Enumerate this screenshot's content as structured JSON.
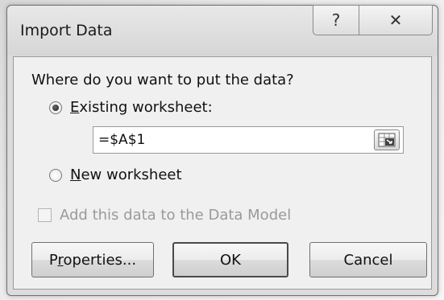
{
  "dialog": {
    "title": "Import Data",
    "help_glyph": "?",
    "close_glyph": "✕"
  },
  "form": {
    "question": "Where do you want to put the data?",
    "existing_worksheet": {
      "first_letter": "E",
      "rest": "xisting worksheet:",
      "selected": true
    },
    "reference": {
      "value": "=$A$1",
      "button_icon": "range-select-icon"
    },
    "new_worksheet": {
      "first_letter": "N",
      "rest": "ew worksheet",
      "selected": false
    },
    "data_model": {
      "label": "Add this data to the Data Model",
      "checked": false,
      "enabled": false
    }
  },
  "buttons": {
    "properties_prefix": "P",
    "properties_accel": "r",
    "properties_suffix": "operties...",
    "ok": "OK",
    "cancel": "Cancel"
  }
}
